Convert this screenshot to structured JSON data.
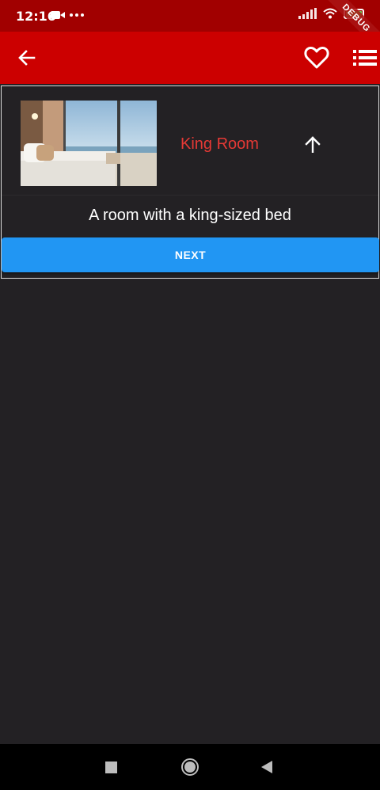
{
  "status_bar": {
    "time": "12:16",
    "icons": [
      "video-camera-icon",
      "more-dots-icon",
      "signal-icon",
      "wifi-icon",
      "battery-icon"
    ],
    "debug_banner": "DEBUG"
  },
  "app_bar": {
    "background": "#cc0000",
    "icons": [
      "arrow-back-icon",
      "heart-outline-icon",
      "list-icon"
    ]
  },
  "room_card": {
    "name": "King Room",
    "name_color": "#e53935",
    "description": "A room with a king-sized bed",
    "toggle_icon": "arrow-up-icon"
  },
  "actions": {
    "next_label": "NEXT",
    "next_color": "#2196f3"
  },
  "nav_bar": {
    "icons": [
      "recent-apps-icon",
      "home-icon",
      "back-icon"
    ]
  }
}
